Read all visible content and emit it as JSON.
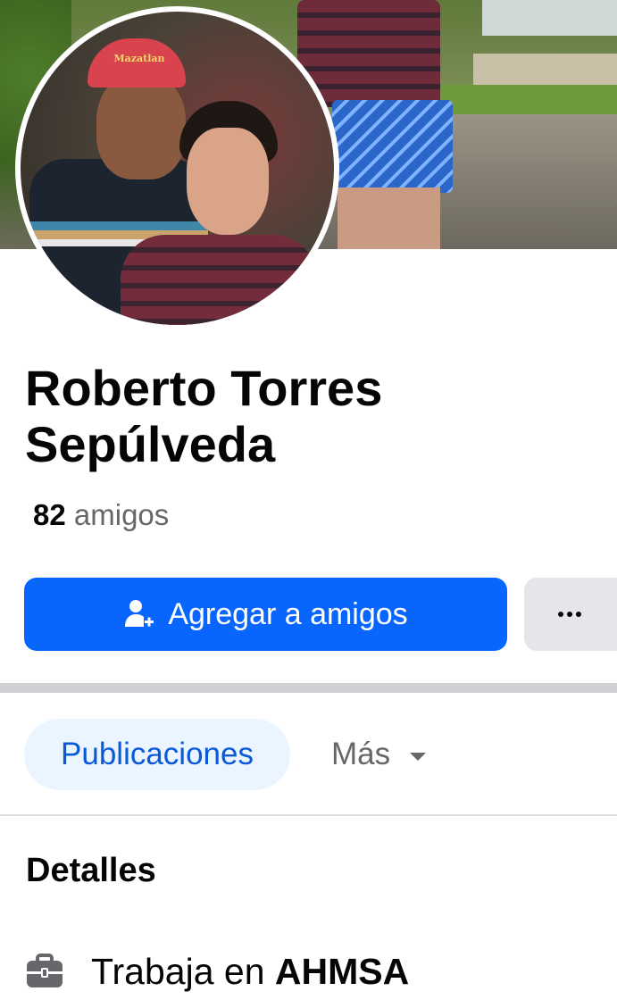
{
  "profile": {
    "name": "Roberto Torres Sepúlveda",
    "friends_count": "82",
    "friends_label": "amigos",
    "cap_text": "Mazatlan"
  },
  "actions": {
    "add_friend_label": "Agregar a amigos",
    "add_friend_icon": "add-friend-icon",
    "more_icon": "more-dots-icon"
  },
  "tabs": [
    {
      "label": "Publicaciones",
      "active": true
    },
    {
      "label": "Más",
      "active": false
    }
  ],
  "details": {
    "title": "Detalles",
    "work_prefix": "Trabaja en",
    "work_company": "AHMSA",
    "work_icon": "briefcase-icon"
  },
  "colors": {
    "primary": "#0866ff",
    "tab_active_bg": "#ebf5ff",
    "tab_active_text": "#0a5ad8",
    "secondary_text": "#65676b",
    "secondary_button": "#e4e6eb"
  }
}
